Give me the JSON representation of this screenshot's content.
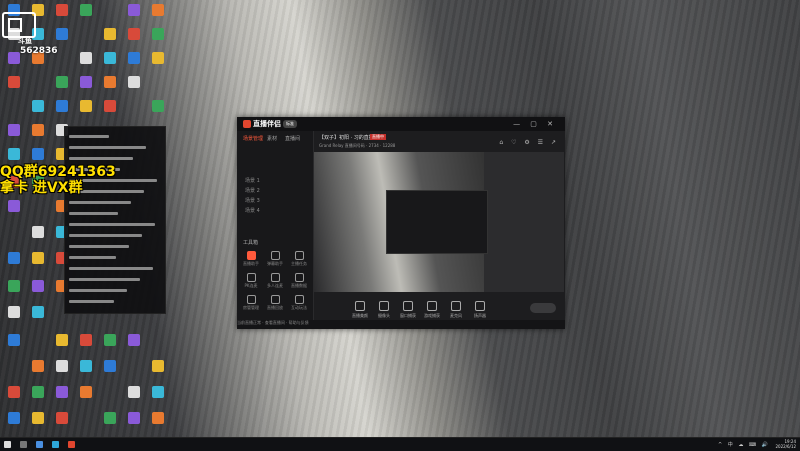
{
  "overlay": {
    "logo_text": "斗鱼",
    "view_count": "562836",
    "promo_line1": "QQ群69241363",
    "promo_line2": "拿卡 进VX群"
  },
  "app": {
    "name": "直播伴侣",
    "badge": "标准",
    "stream_title": "【双子】初阳 · 习的直播",
    "live_tag": "直播中",
    "subtitle": "Grand Relay  直播间号码  ·  2734  ·  12288",
    "sidebar_tabs": [
      "场景管理",
      "素材",
      "直播间"
    ],
    "scenes": [
      "场景 1",
      "场景 2",
      "场景 3",
      "场景 4"
    ],
    "tools_title": "工具箱",
    "tools": [
      "直播助手",
      "弹幕助手",
      "主播任务",
      "PK连麦",
      "多人连麦",
      "直播数据",
      "房管管理",
      "直播回放",
      "互动玩法"
    ],
    "toolbar": [
      "直播美颜",
      "摄像头",
      "窗口捕获",
      "游戏捕获",
      "麦克风",
      "扬声器"
    ],
    "footer": "当前直播正常  ·  查看直播间   ·  帮助与反馈"
  },
  "taskbar": {
    "time": "19:24",
    "date": "2022/6/12",
    "tray": "^ 中 ☁ ⌨ 🔊"
  },
  "colors": {
    "accent": "#ff5a3c",
    "promo": "#ffe000",
    "live": "#c4302b"
  }
}
